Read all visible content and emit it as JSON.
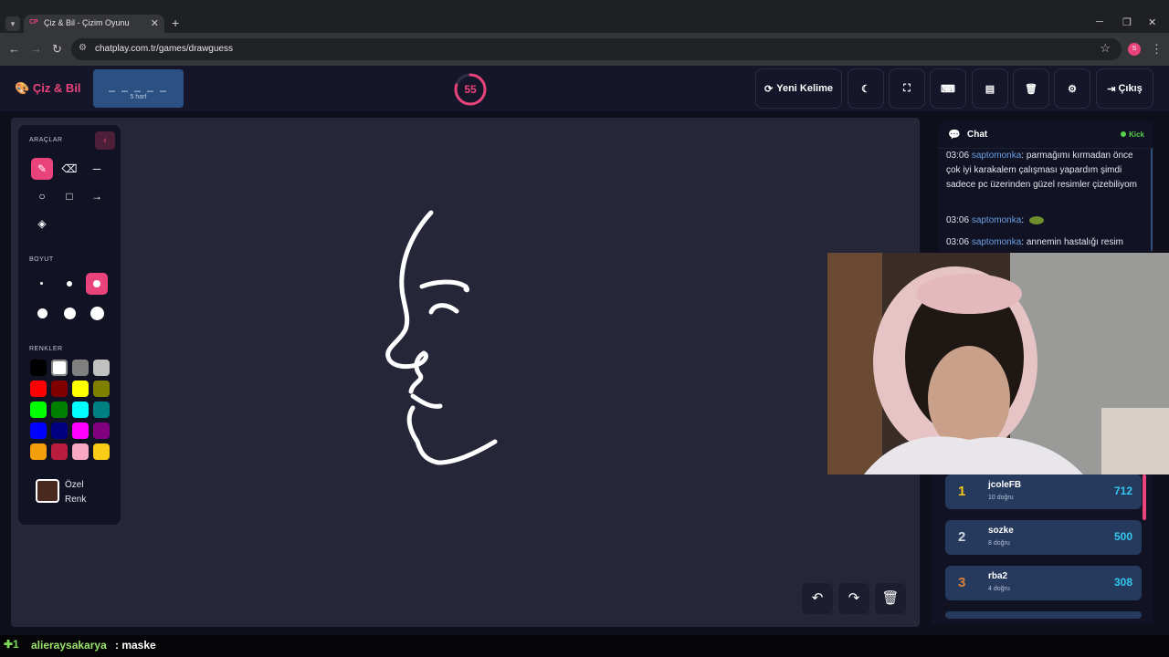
{
  "browser": {
    "tab_title": "Çiz & Bil - Çizim Oyunu",
    "tab_favicon": "CP",
    "url": "chatplay.com.tr/games/drawguess",
    "profile_initial": "S"
  },
  "header": {
    "brand": "Çiz & Bil",
    "brand_icon": "palette-icon",
    "word_mask": "_ _ _ _ _",
    "word_hint": "5 harf",
    "timer": "55",
    "timer_fraction": 0.8,
    "new_word_label": "Yeni Kelime",
    "exit_label": "Çıkış"
  },
  "tools": {
    "tools_title": "ARAÇLAR",
    "size_title": "BOYUT",
    "colors_title": "RENKLER",
    "custom_color_label": "Özel Renk",
    "custom_color": "#4a2a1f",
    "palette": [
      "#000000",
      "#ffffff",
      "#808080",
      "#c0c0c0",
      "#ff0000",
      "#800000",
      "#ffff00",
      "#808000",
      "#00ff00",
      "#008000",
      "#00ffff",
      "#008080",
      "#0000ff",
      "#000080",
      "#ff00ff",
      "#800080",
      "#f59e0b",
      "#b91c3c",
      "#f9a8c4",
      "#facc15"
    ]
  },
  "chat": {
    "title": "Chat",
    "platform": "Kick",
    "messages": [
      {
        "time": "03:06",
        "user": "saptomonka",
        "text": ": parmağımı kırmadan önce çok iyi karakalem çalışması yapardım şimdi sadece pc üzerinden güzel resimler çizebiliyom"
      },
      {
        "time": "03:06",
        "user": "saptomonka",
        "text": ":"
      },
      {
        "time": "03:06",
        "user": "saptomonka",
        "text": ": annemin hastalığı resim"
      }
    ]
  },
  "leaderboard": [
    {
      "rank": "1",
      "name": "jcoleFB",
      "correct": "10 doğru",
      "score": "712",
      "color": "#f5c518"
    },
    {
      "rank": "2",
      "name": "sozke",
      "correct": "8 doğru",
      "score": "500",
      "color": "#d0d4de"
    },
    {
      "rank": "3",
      "name": "rba2",
      "correct": "4 doğru",
      "score": "308",
      "color": "#d9803a"
    }
  ],
  "ticker": {
    "icon": "✚1",
    "user": "alieraysakarya",
    "message": ": maske"
  }
}
